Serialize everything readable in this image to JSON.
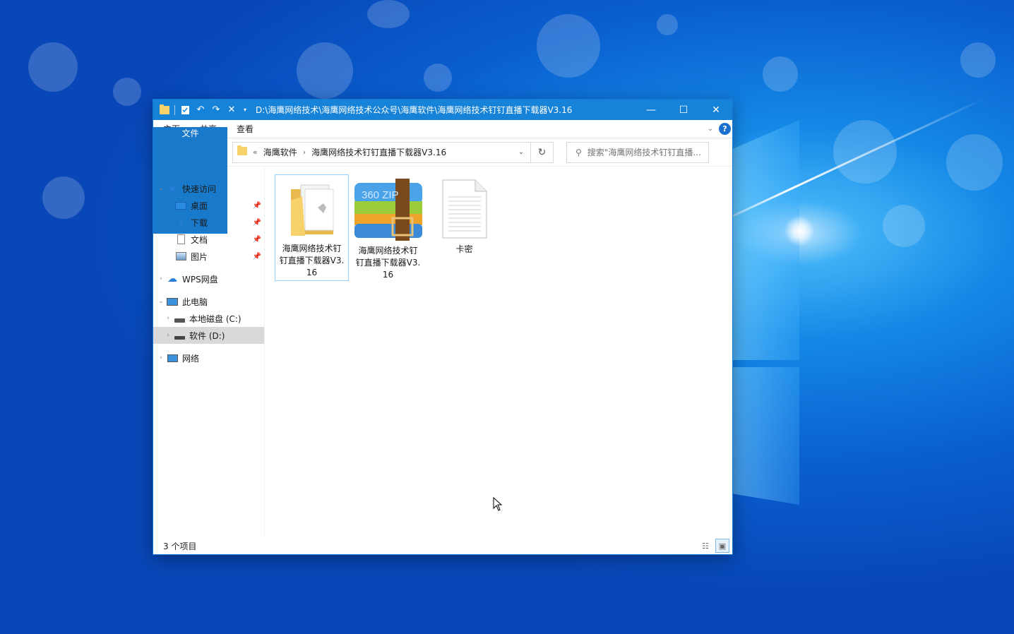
{
  "window": {
    "title": "D:\\海鹰网络技术\\海鹰网络技术公众号\\海鹰软件\\海鹰网络技术钉钉直播下载器V3.16",
    "accent": "#1683d8"
  },
  "ribbon": {
    "tabs": [
      "文件",
      "主页",
      "共享",
      "查看"
    ],
    "help_label": "?"
  },
  "address": {
    "overflow": "«",
    "crumbs": [
      "海鹰软件",
      "海鹰网络技术钉钉直播下载器V3.16"
    ]
  },
  "search": {
    "placeholder": "搜索\"海鹰网络技术钉钉直播..."
  },
  "navpane": {
    "quick_access": "快速访问",
    "quick_items": [
      "桌面",
      "下载",
      "文档",
      "图片"
    ],
    "wps": "WPS网盘",
    "this_pc": "此电脑",
    "drives": [
      "本地磁盘 (C:)",
      "软件 (D:)"
    ],
    "network": "网络"
  },
  "files": [
    {
      "name": "海鹰网络技术钉钉直播下载器V3.16",
      "type": "folder",
      "selected": true
    },
    {
      "name": "海鹰网络技术钉钉直播下载器V3.16",
      "type": "360zip"
    },
    {
      "name": "卡密",
      "type": "text"
    }
  ],
  "zip_icon_text": "360 ZIP",
  "status": {
    "item_count": "3 个项目"
  }
}
